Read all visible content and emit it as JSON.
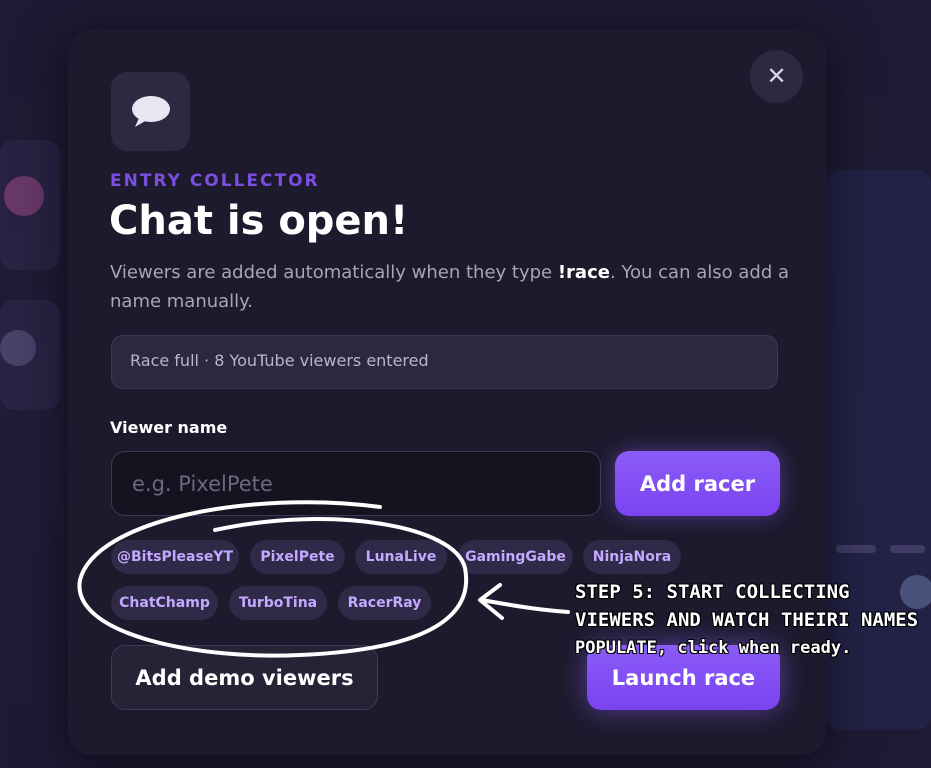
{
  "modal": {
    "eyebrow": "ENTRY COLLECTOR",
    "title": "Chat is open!",
    "description_pre": "Viewers are added automatically when they type ",
    "description_command": "!race",
    "description_post": ". You can also add a name manually.",
    "status": "Race full · 8 YouTube viewers entered",
    "field_label": "Viewer name",
    "input_placeholder": "e.g. PixelPete",
    "input_value": "",
    "add_racer_label": "Add racer",
    "close_label": "✕",
    "chips": [
      "@BitsPleaseYT",
      "PixelPete",
      "LunaLive",
      "GamingGabe",
      "NinjaNora",
      "ChatChamp",
      "TurboTina",
      "RacerRay"
    ],
    "add_demo_label": "Add demo viewers",
    "launch_label": "Launch race"
  },
  "annotation": {
    "line1": "STEP 5: START COLLECTING",
    "line2": "VIEWERS AND WATCH THEIRI NAMES",
    "line3": "POPULATE, click when ready."
  },
  "icons": {
    "app": "chat-bubble-icon",
    "close": "close-icon"
  },
  "colors": {
    "accent": "#8b5cf6",
    "eyebrow": "#7a4fe0",
    "chip_text": "#c5a8ff"
  }
}
